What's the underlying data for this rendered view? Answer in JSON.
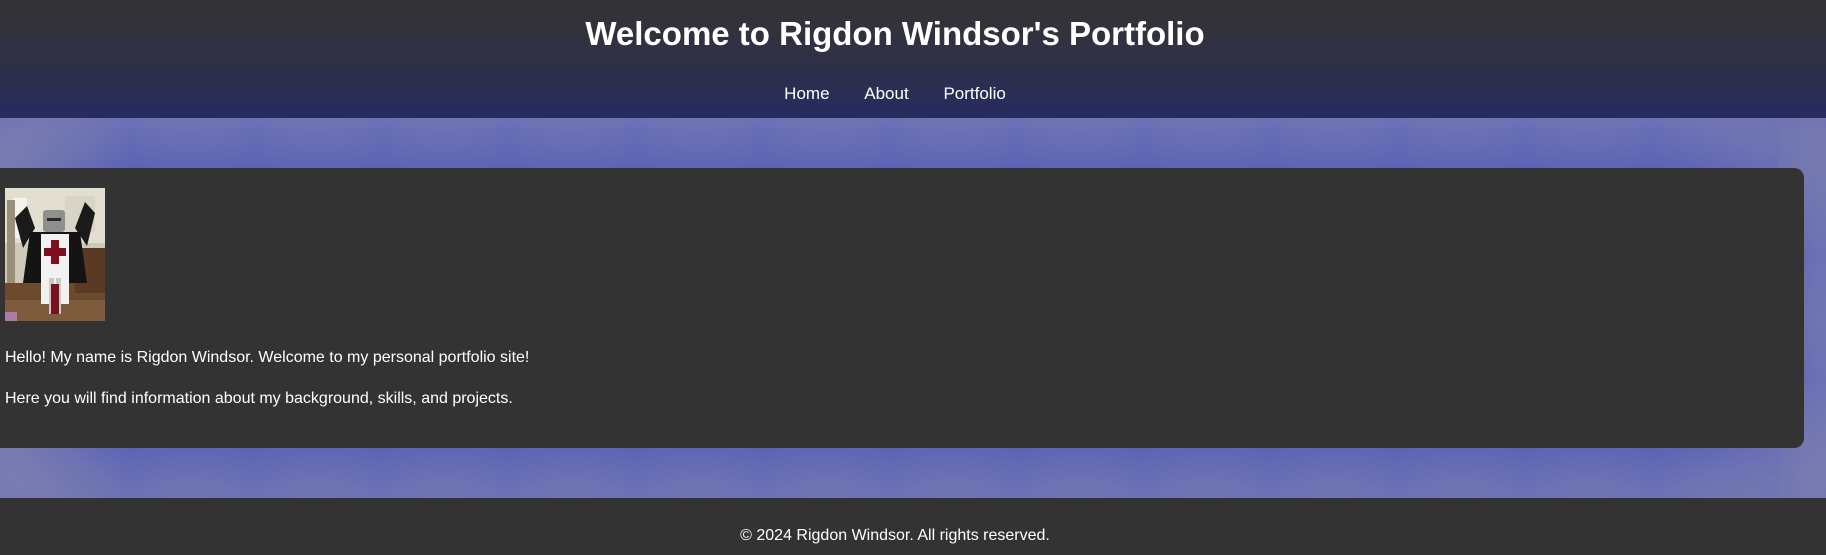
{
  "header": {
    "title": "Welcome to Rigdon Windsor's Portfolio",
    "nav": [
      "Home",
      "About",
      "Portfolio"
    ]
  },
  "main": {
    "photo_icon": "knight-costume-photo",
    "intro": [
      "Hello! My name is Rigdon Windsor. Welcome to my personal portfolio site!",
      "Here you will find information about my background, skills, and projects."
    ]
  },
  "footer": {
    "text": "© 2024 Rigdon Windsor. All rights reserved."
  },
  "colors": {
    "background": "#333333",
    "accent_blue": "#404cbc",
    "header_gradient_end": "#272b60",
    "text": "#ffffff"
  }
}
